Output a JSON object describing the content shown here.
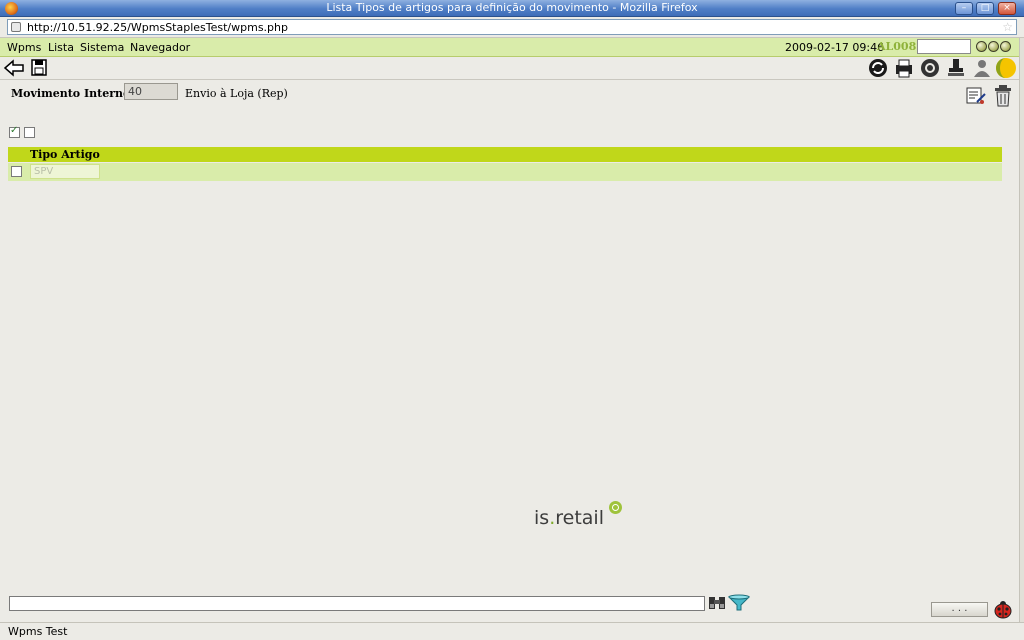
{
  "window": {
    "title": "Lista Tipos de artigos para definição do movimento - Mozilla Firefox",
    "min_glyph": "–",
    "max_glyph": "□",
    "close_glyph": "×"
  },
  "browser": {
    "url": "http://10.51.92.25/WpmsStaplesTest/wpms.php",
    "star_glyph": "☆"
  },
  "menu": {
    "items": [
      "Wpms",
      "Lista",
      "Sistema",
      "Navegador"
    ],
    "datetime": "2009-02-17 09:46",
    "user_code": "AL008",
    "quick_input_value": ""
  },
  "form": {
    "label": "Movimento Interno:",
    "value": "40",
    "description": "Envio à Loja (Rep)"
  },
  "filters": {
    "checkbox_1_checked": true,
    "checkbox_2_checked": false
  },
  "grid": {
    "column_header": "Tipo Artigo",
    "rows": [
      {
        "checked": false,
        "value": "SPV"
      }
    ]
  },
  "logo": {
    "prefix": "is",
    "dot": ".",
    "suffix": "retail"
  },
  "footer": {
    "command_value": "",
    "ellipsis_label": ". . .",
    "status_text": "Wpms Test"
  },
  "icons": {
    "toolbar_left": [
      "back-arrow-icon",
      "save-icon"
    ],
    "toolbar_right": [
      "refresh-icon",
      "print-icon",
      "lifebuoy-icon",
      "stamp-icon",
      "user-icon",
      "globe-icon"
    ],
    "form_actions": [
      "edit-document-icon",
      "trash-icon"
    ],
    "search": [
      "binoculars-icon",
      "filter-icon"
    ],
    "bug": "ladybug-icon"
  },
  "colors": {
    "menu_bg": "#d9ecaa",
    "grid_header_bg": "#c0d71a",
    "user_code": "#8fb23a",
    "page_bg": "#ecebe6"
  }
}
